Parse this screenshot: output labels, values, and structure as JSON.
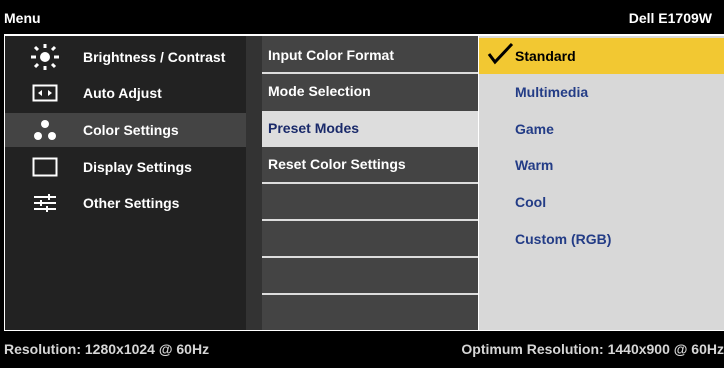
{
  "header": {
    "menu_label": "Menu",
    "model": "Dell E1709W"
  },
  "sidebar": {
    "items": [
      {
        "label": "Brightness / Contrast",
        "icon": "brightness-icon"
      },
      {
        "label": "Auto Adjust",
        "icon": "auto-adjust-icon"
      },
      {
        "label": "Color Settings",
        "icon": "color-settings-icon",
        "selected": true
      },
      {
        "label": "Display Settings",
        "icon": "display-settings-icon"
      },
      {
        "label": "Other Settings",
        "icon": "other-settings-icon"
      }
    ]
  },
  "submenu": {
    "items": [
      {
        "label": "Input Color Format"
      },
      {
        "label": "Mode Selection"
      },
      {
        "label": "Preset Modes",
        "selected": true
      },
      {
        "label": "Reset Color Settings"
      }
    ]
  },
  "options": {
    "items": [
      {
        "label": "Standard",
        "selected": true
      },
      {
        "label": "Multimedia"
      },
      {
        "label": "Game"
      },
      {
        "label": "Warm"
      },
      {
        "label": "Cool"
      },
      {
        "label": "Custom (RGB)"
      }
    ]
  },
  "footer": {
    "resolution": "Resolution: 1280x1024 @ 60Hz",
    "optimum": "Optimum Resolution: 1440x900 @ 60Hz"
  },
  "colors": {
    "selection_highlight": "#f2c832",
    "option_text": "#233c86"
  }
}
